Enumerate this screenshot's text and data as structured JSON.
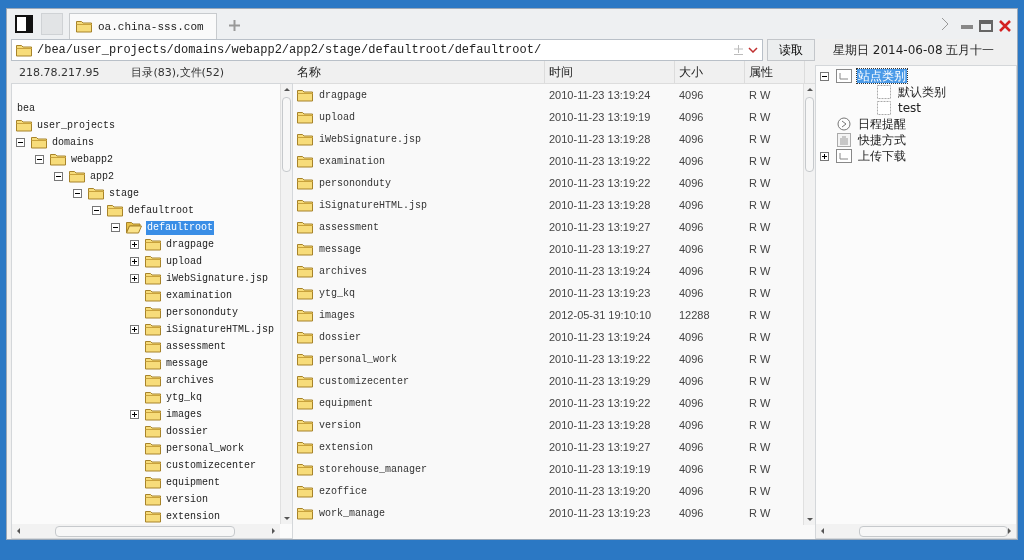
{
  "tab": {
    "title": "oa.china-sss.com",
    "selected": true
  },
  "address": {
    "path": "/bea/user_projects/domains/webapp2/app2/stage/defaultroot/defaultroot/",
    "button": "读取"
  },
  "status": {
    "host": "218.78.217.95",
    "counts": "目录(83),文件(52)"
  },
  "columns": [
    "名称",
    "时间",
    "大小",
    "属性"
  ],
  "tree": {
    "root_label": "bea",
    "nodes": [
      {
        "label": "user_projects",
        "selected": false,
        "children": [
          {
            "label": "domains",
            "expanded": true,
            "selected": false,
            "children": [
              {
                "label": "webapp2",
                "expanded": true,
                "selected": false,
                "children": [
                  {
                    "label": "app2",
                    "expanded": true,
                    "selected": false,
                    "children": [
                      {
                        "label": "stage",
                        "expanded": true,
                        "selected": false,
                        "children": [
                          {
                            "label": "defaultroot",
                            "expanded": true,
                            "selected": false,
                            "children": [
                              {
                                "label": "defaultroot",
                                "expanded": true,
                                "selected": true,
                                "children": [
                                  {
                                    "label": "dragpage",
                                    "expanded": false,
                                    "selected": false
                                  },
                                  {
                                    "label": "upload",
                                    "expanded": false,
                                    "selected": false
                                  },
                                  {
                                    "label": "iWebSignature.jsp",
                                    "expanded": false,
                                    "selected": false
                                  },
                                  {
                                    "label": "examination",
                                    "selected": false
                                  },
                                  {
                                    "label": "persononduty",
                                    "selected": false
                                  },
                                  {
                                    "label": "iSignatureHTML.jsp",
                                    "expanded": false,
                                    "selected": false
                                  },
                                  {
                                    "label": "assessment",
                                    "selected": false
                                  },
                                  {
                                    "label": "message",
                                    "selected": false
                                  },
                                  {
                                    "label": "archives",
                                    "selected": false
                                  },
                                  {
                                    "label": "ytg_kq",
                                    "selected": false
                                  },
                                  {
                                    "label": "images",
                                    "expanded": false,
                                    "selected": false
                                  },
                                  {
                                    "label": "dossier",
                                    "selected": false
                                  },
                                  {
                                    "label": "personal_work",
                                    "selected": false
                                  },
                                  {
                                    "label": "customizecenter",
                                    "selected": false
                                  },
                                  {
                                    "label": "equipment",
                                    "selected": false
                                  },
                                  {
                                    "label": "version",
                                    "selected": false
                                  },
                                  {
                                    "label": "extension",
                                    "selected": false
                                  }
                                ]
                              }
                            ]
                          }
                        ]
                      }
                    ]
                  }
                ]
              }
            ]
          }
        ]
      }
    ]
  },
  "files": [
    {
      "name": "dragpage",
      "time": "2010-11-23 13:19:24",
      "size": "4096",
      "attr": "R W"
    },
    {
      "name": "upload",
      "time": "2010-11-23 13:19:19",
      "size": "4096",
      "attr": "R W"
    },
    {
      "name": "iWebSignature.jsp",
      "time": "2010-11-23 13:19:28",
      "size": "4096",
      "attr": "R W"
    },
    {
      "name": "examination",
      "time": "2010-11-23 13:19:22",
      "size": "4096",
      "attr": "R W"
    },
    {
      "name": "persononduty",
      "time": "2010-11-23 13:19:22",
      "size": "4096",
      "attr": "R W"
    },
    {
      "name": "iSignatureHTML.jsp",
      "time": "2010-11-23 13:19:28",
      "size": "4096",
      "attr": "R W"
    },
    {
      "name": "assessment",
      "time": "2010-11-23 13:19:27",
      "size": "4096",
      "attr": "R W"
    },
    {
      "name": "message",
      "time": "2010-11-23 13:19:27",
      "size": "4096",
      "attr": "R W"
    },
    {
      "name": "archives",
      "time": "2010-11-23 13:19:24",
      "size": "4096",
      "attr": "R W"
    },
    {
      "name": "ytg_kq",
      "time": "2010-11-23 13:19:23",
      "size": "4096",
      "attr": "R W"
    },
    {
      "name": "images",
      "time": "2012-05-31 19:10:10",
      "size": "12288",
      "attr": "R W"
    },
    {
      "name": "dossier",
      "time": "2010-11-23 13:19:24",
      "size": "4096",
      "attr": "R W"
    },
    {
      "name": "personal_work",
      "time": "2010-11-23 13:19:22",
      "size": "4096",
      "attr": "R W"
    },
    {
      "name": "customizecenter",
      "time": "2010-11-23 13:19:29",
      "size": "4096",
      "attr": "R W"
    },
    {
      "name": "equipment",
      "time": "2010-11-23 13:19:22",
      "size": "4096",
      "attr": "R W"
    },
    {
      "name": "version",
      "time": "2010-11-23 13:19:28",
      "size": "4096",
      "attr": "R W"
    },
    {
      "name": "extension",
      "time": "2010-11-23 13:19:27",
      "size": "4096",
      "attr": "R W"
    },
    {
      "name": "storehouse_manager",
      "time": "2010-11-23 13:19:19",
      "size": "4096",
      "attr": "R W"
    },
    {
      "name": "ezoffice",
      "time": "2010-11-23 13:19:20",
      "size": "4096",
      "attr": "R W"
    },
    {
      "name": "work_manage",
      "time": "2010-11-23 13:19:23",
      "size": "4096",
      "attr": "R W"
    }
  ],
  "date": "星期日 2014-06-08 五月十一",
  "side_tree": [
    {
      "label": "站点类别",
      "kind": "category",
      "expanded": true,
      "selected": true,
      "children": [
        {
          "label": "默认类别",
          "kind": "item",
          "selected": false
        },
        {
          "label": "test",
          "kind": "item",
          "selected": false
        }
      ]
    },
    {
      "label": "日程提醒",
      "kind": "schedule",
      "selected": false
    },
    {
      "label": "快捷方式",
      "kind": "shortcut",
      "selected": false
    },
    {
      "label": "上传下载",
      "kind": "category",
      "expanded": false,
      "selected": false
    }
  ]
}
